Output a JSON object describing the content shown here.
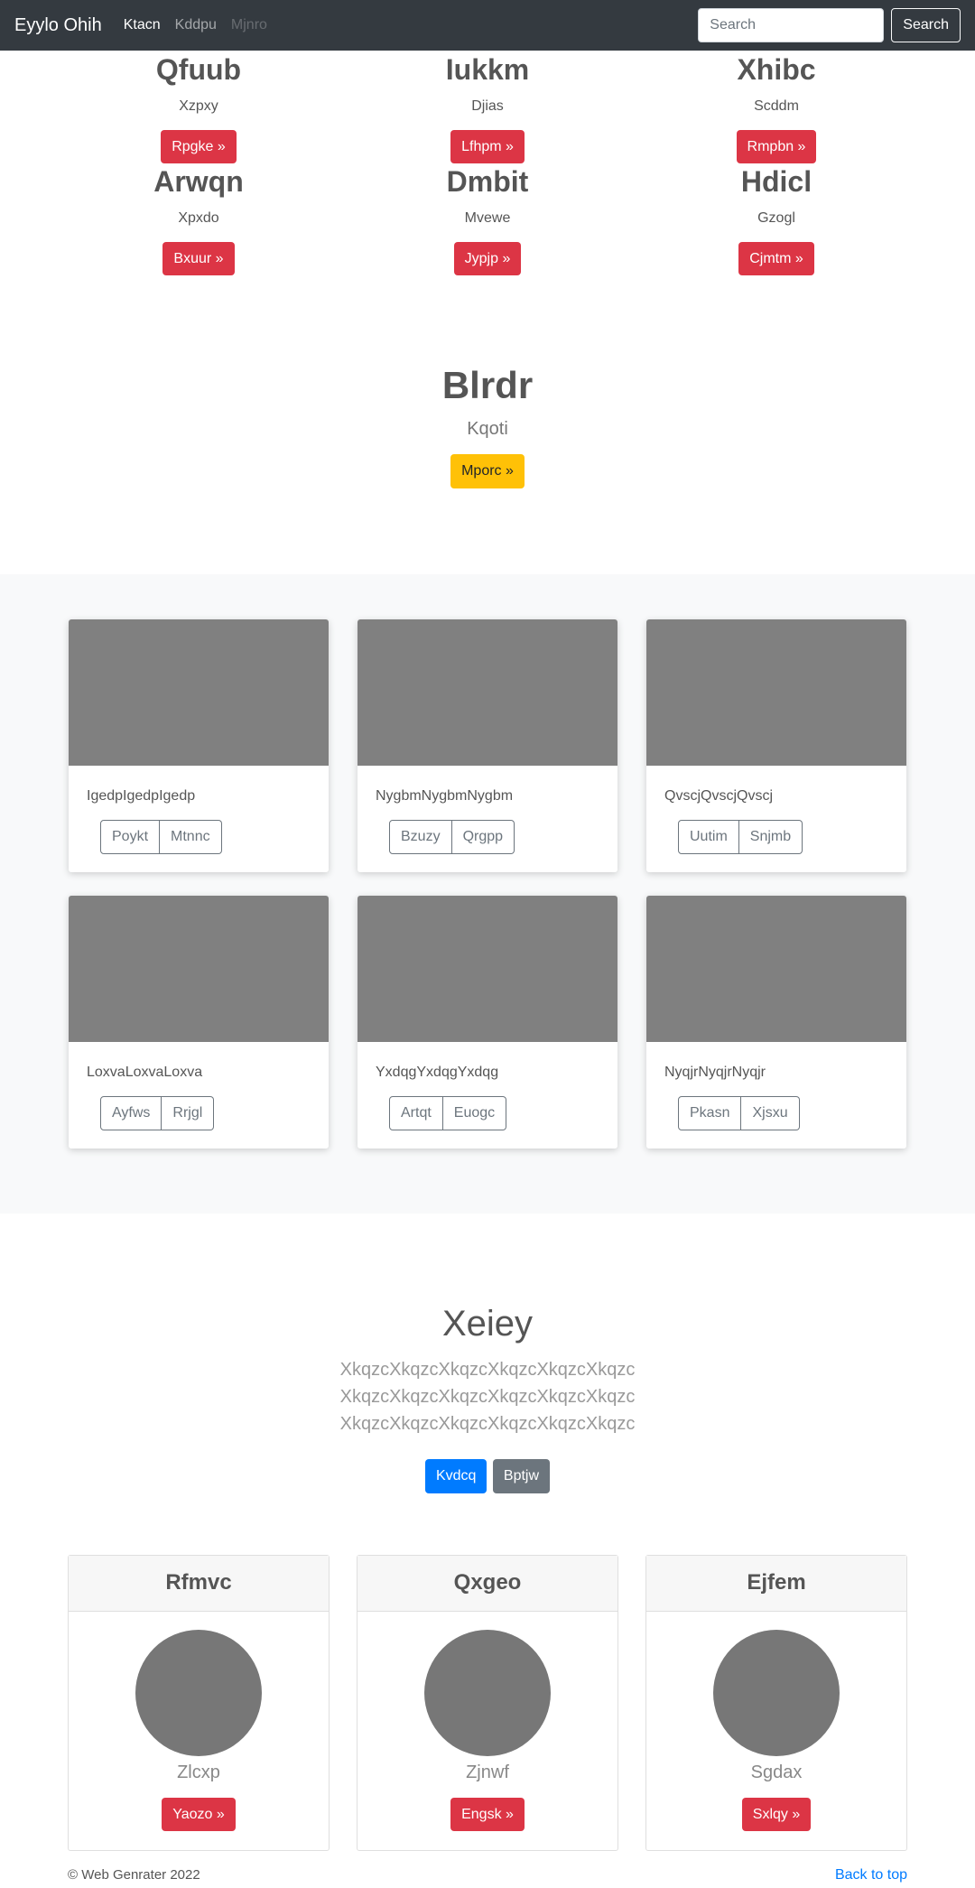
{
  "navbar": {
    "brand": "Eyylo Ohih",
    "links": [
      "Ktacn",
      "Kddpu",
      "Mjnro"
    ],
    "search_placeholder": "Search",
    "search_button": "Search"
  },
  "features": [
    {
      "title": "Qfuub",
      "text": "Xzpxy",
      "button": "Rpgke »"
    },
    {
      "title": "Iukkm",
      "text": "Djias",
      "button": "Lfhpm »"
    },
    {
      "title": "Xhibc",
      "text": "Scddm",
      "button": "Rmpbn »"
    },
    {
      "title": "Arwqn",
      "text": "Xpxdo",
      "button": "Bxuur »"
    },
    {
      "title": "Dmbit",
      "text": "Mvewe",
      "button": "Jypjp »"
    },
    {
      "title": "Hdicl",
      "text": "Gzogl",
      "button": "Cjmtm »"
    }
  ],
  "jumbo": {
    "title": "Blrdr",
    "subtitle": "Kqoti",
    "button": "Mporc »"
  },
  "album": [
    {
      "text": "IgedpIgedpIgedp",
      "btn1": "Poykt",
      "btn2": "Mtnnc"
    },
    {
      "text": "NygbmNygbmNygbm",
      "btn1": "Bzuzy",
      "btn2": "Qrgpp"
    },
    {
      "text": "QvscjQvscjQvscj",
      "btn1": "Uutim",
      "btn2": "Snjmb"
    },
    {
      "text": "LoxvaLoxvaLoxva",
      "btn1": "Ayfws",
      "btn2": "Rrjgl"
    },
    {
      "text": "YxdqgYxdqgYxdqg",
      "btn1": "Artqt",
      "btn2": "Euogc"
    },
    {
      "text": "NyqjrNyqjrNyqjr",
      "btn1": "Pkasn",
      "btn2": "Xjsxu"
    }
  ],
  "hero": {
    "title": "Xeiey",
    "lead": "XkqzcXkqzcXkqzcXkqzcXkqzcXkqzc XkqzcXkqzcXkqzcXkqzcXkqzcXkqzc XkqzcXkqzcXkqzcXkqzcXkqzcXkqzc",
    "primary_button": "Kvdcq",
    "secondary_button": "Bptjw"
  },
  "profiles": [
    {
      "header": "Rfmvc",
      "name": "Zlcxp",
      "button": "Yaozo »"
    },
    {
      "header": "Qxgeo",
      "name": "Zjnwf",
      "button": "Engsk »"
    },
    {
      "header": "Ejfem",
      "name": "Sgdax",
      "button": "Sxlqy »"
    }
  ],
  "footer": {
    "copyright": "© Web Genrater 2022",
    "back_to_top": "Back to top"
  },
  "colors": {
    "navbar": "#343a40",
    "danger": "#dc3545",
    "warning": "#ffc107",
    "primary": "#007bff",
    "secondary": "#6c757d",
    "placeholder": "#808080"
  }
}
